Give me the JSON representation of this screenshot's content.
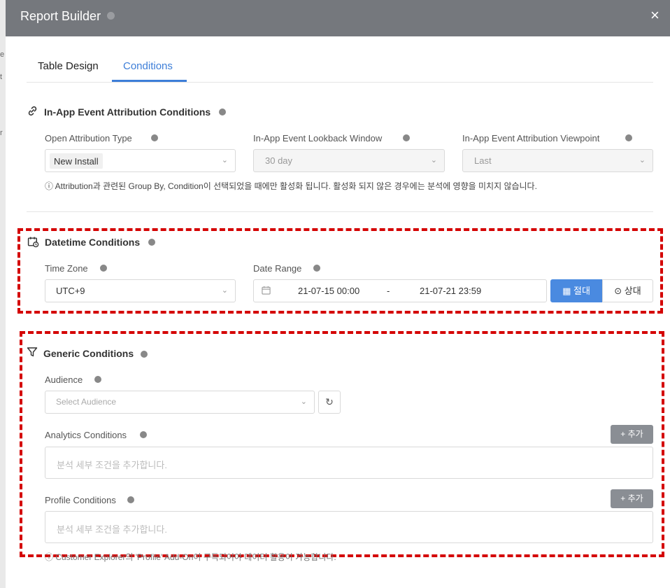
{
  "window": {
    "title": "Report Builder",
    "close_label": "×"
  },
  "background_glyphs": [
    "e",
    "t",
    "r"
  ],
  "tabs": [
    {
      "label": "Table Design"
    },
    {
      "label": "Conditions"
    }
  ],
  "attribution": {
    "title": "In-App Event Attribution Conditions",
    "fields": [
      {
        "label": "Open Attribution Type",
        "value": "New Install"
      },
      {
        "label": "In-App Event Lookback Window",
        "value": "30 day"
      },
      {
        "label": "In-App Event Attribution Viewpoint",
        "value": "Last"
      }
    ],
    "note": "ⓘ Attribution과 관련된 Group By, Condition이 선택되었을 때에만 활성화 됩니다. 활성화 되지 않은 경우에는 분석에 영향을 미치지 않습니다."
  },
  "datetime": {
    "title": "Datetime Conditions",
    "timezone_label": "Time Zone",
    "timezone_value": "UTC+9",
    "daterange_label": "Date Range",
    "start": "21-07-15 00:00",
    "separator": "-",
    "end": "21-07-21 23:59",
    "absolute_label": "절대",
    "relative_label": "상대"
  },
  "generic": {
    "title": "Generic Conditions",
    "audience_label": "Audience",
    "audience_placeholder": "Select Audience",
    "analytics_label": "Analytics Conditions",
    "analytics_add": "+ 추가",
    "analytics_placeholder": "분석 세부 조건을 추가합니다.",
    "profile_label": "Profile Conditions",
    "profile_add": "+ 추가",
    "profile_placeholder": "분석 세부 조건을 추가합니다."
  },
  "bottom_note": "ⓘ Customer Explorer의 'Profile' Add-On이 구독되어야 데이터 활용이 가능합니다.",
  "colors": {
    "accent": "#3d7ed8",
    "header": "#75787d",
    "highlight": "#d40000"
  }
}
